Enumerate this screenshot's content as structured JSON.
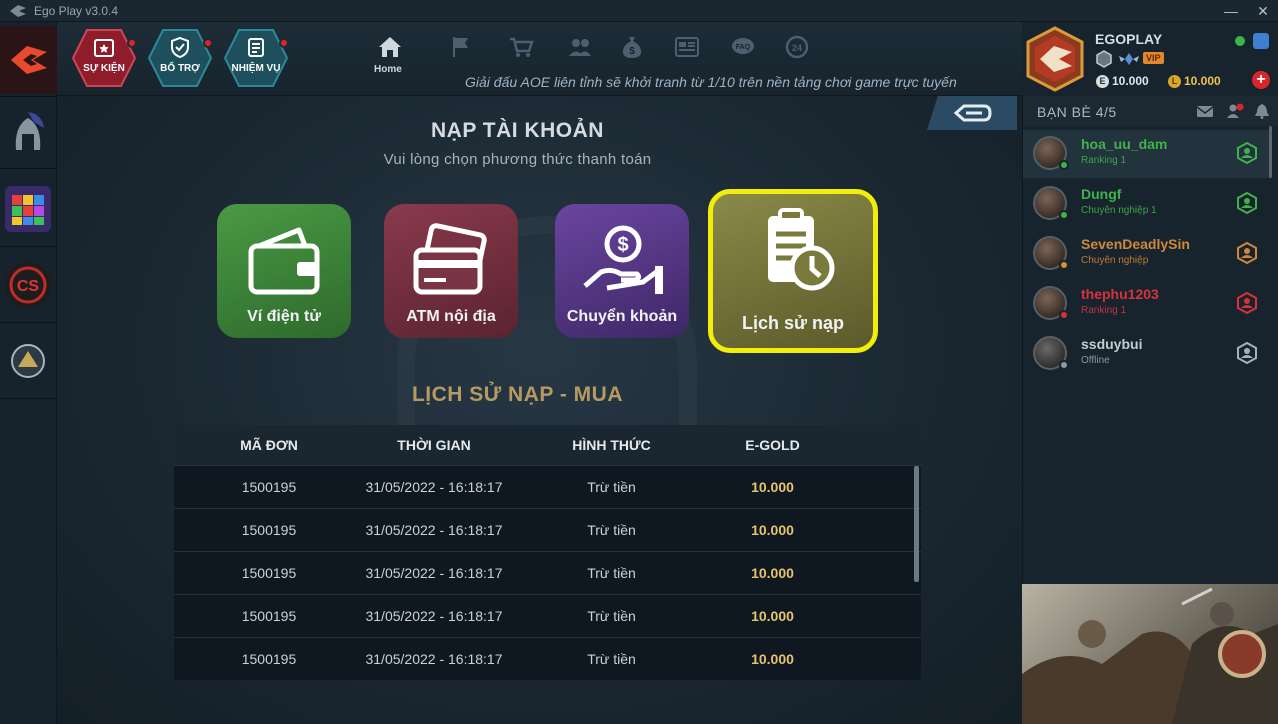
{
  "window": {
    "title": "Ego Play v3.0.4",
    "minimize": "—",
    "close": "✕"
  },
  "header": {
    "hex_buttons": [
      {
        "label": "SỰ KIỆN",
        "color": "#8e1c2a"
      },
      {
        "label": "BỔ TRỢ",
        "color": "#1d5f6c"
      },
      {
        "label": "NHIỆM VỤ",
        "color": "#1d5f6c"
      }
    ],
    "nav": [
      {
        "icon": "home-icon",
        "label": "Home"
      },
      {
        "icon": "flag-icon"
      },
      {
        "icon": "cart-icon"
      },
      {
        "icon": "friends-icon"
      },
      {
        "icon": "money-bag-icon"
      },
      {
        "icon": "news-icon"
      },
      {
        "icon": "faq-icon",
        "text": "FAQ"
      },
      {
        "icon": "support-24-icon",
        "text": "24"
      }
    ],
    "ticker": "Giải đấu AOE liên tỉnh sẽ khởi tranh từ 1/10 trên nền tảng chơi game trực tuyến"
  },
  "profile": {
    "username": "EGOPLAY",
    "vip": "VIP",
    "ecoin": "10.000",
    "lcoin": "10.000",
    "ecoin_symbol": "E",
    "lcoin_symbol": "L"
  },
  "friends": {
    "title": "BẠN BÈ 4/5",
    "items": [
      {
        "name": "hoa_uu_dam",
        "rank": "Ranking 1",
        "name_color": "#3fb24c",
        "rank_color": "#3fa24a",
        "status_color": "#3cb44a",
        "icon_color": "#3fb24c"
      },
      {
        "name": "Dungf",
        "rank": "Chuyên nghiệp 1",
        "name_color": "#3fb24c",
        "rank_color": "#3fa24a",
        "status_color": "#3cb44a",
        "icon_color": "#3fb24c"
      },
      {
        "name": "SevenDeadlySin",
        "rank": "Chuyên nghiệp",
        "name_color": "#d0873b",
        "rank_color": "#c07a35",
        "status_color": "#e08a2e",
        "icon_color": "#d0873b"
      },
      {
        "name": "thephu1203",
        "rank": "Ranking 1",
        "name_color": "#d7323a",
        "rank_color": "#c0353c",
        "status_color": "#e02c34",
        "icon_color": "#d7323a"
      },
      {
        "name": "ssduybui",
        "rank": "Offline",
        "name_color": "#c5ccd1",
        "rank_color": "#8c979e",
        "status_color": "#8e989f",
        "icon_color": "#a8b1b7"
      }
    ]
  },
  "main": {
    "title": "NẠP TÀI KHOẢN",
    "subtitle": "Vui lòng chọn phương thức thanh toán",
    "payment_methods": [
      {
        "label": "Ví điện tử",
        "color": "#3d8a3a",
        "icon": "wallet-icon"
      },
      {
        "label": "ATM nội địa",
        "color": "#7a3444",
        "icon": "credit-card-icon"
      },
      {
        "label": "Chuyển khoản",
        "color": "#5b3a8c",
        "icon": "money-hand-icon"
      },
      {
        "label": "Lịch sử nạp",
        "color": "#7a7a3c",
        "icon": "clipboard-clock-icon",
        "selected": true
      }
    ],
    "history_title": "LỊCH SỬ NẠP - MUA",
    "table": {
      "columns": [
        "MÃ ĐƠN",
        "THỜI GIAN",
        "HÌNH THỨC",
        "E-GOLD"
      ],
      "rows": [
        [
          "1500195",
          "31/05/2022 - 16:18:17",
          "Trừ tiền",
          "10.000"
        ],
        [
          "1500195",
          "31/05/2022 - 16:18:17",
          "Trừ tiền",
          "10.000"
        ],
        [
          "1500195",
          "31/05/2022 - 16:18:17",
          "Trừ tiền",
          "10.000"
        ],
        [
          "1500195",
          "31/05/2022 - 16:18:17",
          "Trừ tiền",
          "10.000"
        ],
        [
          "1500195",
          "31/05/2022 - 16:18:17",
          "Trừ tiền",
          "10.000"
        ]
      ]
    }
  },
  "sidebar_games": [
    "spartan-helmet-icon",
    "block-puzzle-icon",
    "cs-logo-icon",
    "aoe-logo-icon"
  ]
}
